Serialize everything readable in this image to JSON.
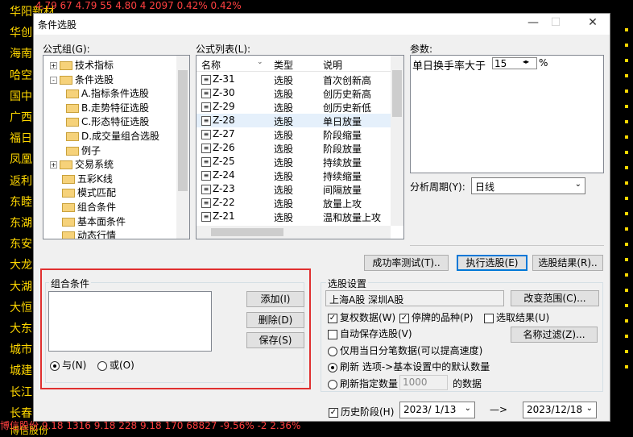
{
  "background": {
    "side_labels": [
      "华阳新材",
      "华创",
      "海南",
      "哈空",
      "国中",
      "广西",
      "福日",
      "凤凰",
      "返利",
      "东睦",
      "东湖",
      "东安",
      "大龙",
      "大湖",
      "大恒",
      "大东",
      "城市",
      "城建",
      "长江",
      "长春",
      "博信股份"
    ],
    "top_row": "4.79     67    4.79     55     4.80     4     2097    0.42%         0.42%",
    "bottom_row": "博信股份       9.18    1316     9.18     228     9.18     170    68827    -9.56%    -2     2.36%"
  },
  "dialog": {
    "title": "条件选股",
    "controls": {
      "minimize": "—",
      "maximize": "☐",
      "close": "✕"
    },
    "formula_group_label": "公式组(G):",
    "tree": [
      {
        "label": "技术指标",
        "expander": "+"
      },
      {
        "label": "条件选股",
        "expander": "-"
      },
      {
        "label": "A.指标条件选股",
        "expander": ""
      },
      {
        "label": "B.走势特征选股",
        "expander": ""
      },
      {
        "label": "C.形态特征选股",
        "expander": ""
      },
      {
        "label": "D.成交量组合选股",
        "expander": ""
      },
      {
        "label": "例子",
        "expander": ""
      },
      {
        "label": "交易系统",
        "expander": "+"
      },
      {
        "label": "五彩K线",
        "expander": ""
      },
      {
        "label": "模式匹配",
        "expander": ""
      },
      {
        "label": "组合条件",
        "expander": ""
      },
      {
        "label": "基本面条件",
        "expander": ""
      },
      {
        "label": "动态行情",
        "expander": ""
      }
    ],
    "formula_list_label": "公式列表(L):",
    "formula_columns": [
      "名称",
      "类型",
      "说明"
    ],
    "formulas": [
      {
        "name": "Z-31",
        "type": "选股",
        "desc": "首次创新高"
      },
      {
        "name": "Z-30",
        "type": "选股",
        "desc": "创历史新高"
      },
      {
        "name": "Z-29",
        "type": "选股",
        "desc": "创历史新低"
      },
      {
        "name": "Z-28",
        "type": "选股",
        "desc": "单日放量"
      },
      {
        "name": "Z-27",
        "type": "选股",
        "desc": "阶段缩量"
      },
      {
        "name": "Z-26",
        "type": "选股",
        "desc": "阶段放量"
      },
      {
        "name": "Z-25",
        "type": "选股",
        "desc": "持续放量"
      },
      {
        "name": "Z-24",
        "type": "选股",
        "desc": "持续缩量"
      },
      {
        "name": "Z-23",
        "type": "选股",
        "desc": "间隔放量"
      },
      {
        "name": "Z-22",
        "type": "选股",
        "desc": "放量上攻"
      },
      {
        "name": "Z-21",
        "type": "选股",
        "desc": "温和放量上攻"
      }
    ],
    "params_label": "参数:",
    "param_text": "单日换手率大于",
    "param_value": "15",
    "param_unit": "%",
    "period_label": "分析周期(Y):",
    "period_value": "日线",
    "btn_success_rate": "成功率测试(T)..",
    "btn_execute": "执行选股(E)",
    "btn_result": "选股结果(R)..",
    "combo_group_label": "组合条件",
    "btn_add": "添加(I)",
    "btn_delete": "删除(D)",
    "btn_save": "保存(S)",
    "radio_and": "与(N)",
    "radio_or": "或(O)",
    "settings_label": "选股设置",
    "market_text": "上海A股  深圳A股",
    "btn_change_range": "改变范围(C)...",
    "chk_rights": "复权数据(W)",
    "chk_suspended": "停牌的品种(P)",
    "chk_result": "选取结果(U)",
    "chk_autosave": "自动保存选股(V)",
    "btn_name_filter": "名称过滤(Z)...",
    "radio_today": "仅用当日分笔数据(可以提高速度)",
    "radio_refresh": "刷新 选项->基本设置中的默认数量",
    "radio_refresh_n": "刷新指定数量",
    "refresh_n_value": "1000",
    "refresh_n_suffix": "的数据",
    "chk_history": "历史阶段(H)",
    "date_from": "2023/ 1/13",
    "arrow": "—>",
    "date_to": "2023/12/18"
  }
}
